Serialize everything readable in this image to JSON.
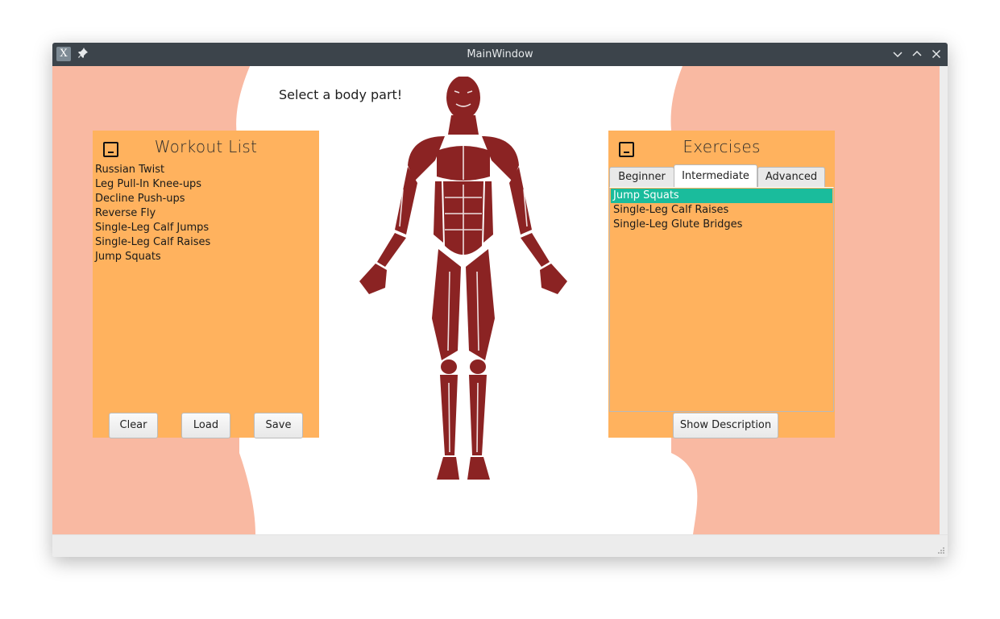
{
  "window": {
    "title": "MainWindow"
  },
  "main": {
    "prompt": "Select a body part!"
  },
  "workout_panel": {
    "title": "Workout List",
    "items": [
      "Russian Twist",
      "Leg Pull-In Knee-ups",
      "Decline Push-ups",
      "Reverse Fly",
      "Single-Leg Calf Jumps",
      "Single-Leg Calf Raises",
      "Jump Squats"
    ],
    "buttons": {
      "clear": "Clear",
      "load": "Load",
      "save": "Save"
    }
  },
  "exercises_panel": {
    "title": "Exercises",
    "tabs": [
      {
        "label": "Beginner",
        "active": false
      },
      {
        "label": "Intermediate",
        "active": true
      },
      {
        "label": "Advanced",
        "active": false
      }
    ],
    "items": [
      "Jump Squats",
      "Single-Leg Calf Raises",
      "Single-Leg Glute Bridges"
    ],
    "selected_index": 0,
    "show_description": "Show Description"
  },
  "colors": {
    "panel": "#ffb25e",
    "background_shape": "#f9b9a2",
    "muscle": "#8b2323",
    "selection": "#1abc9c",
    "titlebar": "#3c444b"
  },
  "icons": {
    "app": "x-app-icon",
    "pin": "pin-icon",
    "minimize": "chevron-down-icon",
    "maximize": "chevron-up-icon",
    "close": "close-icon",
    "float": "dock-float-icon"
  }
}
